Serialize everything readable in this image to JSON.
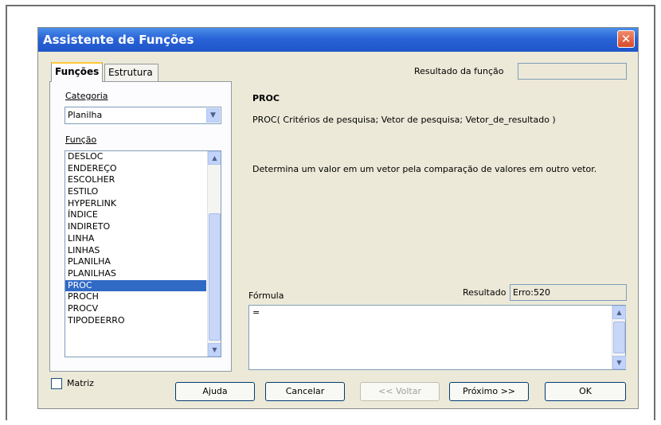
{
  "window": {
    "title": "Assistente de Funções"
  },
  "tabs": {
    "functions": "Funções",
    "structure": "Estrutura"
  },
  "category": {
    "label": "Categoria",
    "selected": "Planilha"
  },
  "function_list": {
    "label": "Função",
    "items": [
      "DESLOC",
      "ENDEREÇO",
      "ESCOLHER",
      "ESTILO",
      "HYPERLINK",
      "ÍNDICE",
      "INDIRETO",
      "LINHA",
      "LINHAS",
      "PLANILHA",
      "PLANILHAS",
      "PROC",
      "PROCH",
      "PROCV",
      "TIPODEERRO"
    ],
    "selected": "PROC"
  },
  "function_result": {
    "label": "Resultado da função",
    "value": ""
  },
  "details": {
    "name": "PROC",
    "syntax": "PROC( Critérios de pesquisa; Vetor de pesquisa; Vetor_de_resultado )",
    "description": "Determina um valor em um vetor pela comparação de valores em outro vetor."
  },
  "formula": {
    "label": "Fórmula",
    "value": "=",
    "result_label": "Resultado",
    "result_value": "Erro:520"
  },
  "footer": {
    "matrix": "Matriz",
    "help": "Ajuda",
    "cancel": "Cancelar",
    "back": "<< Voltar",
    "next": "Próximo >>",
    "ok": "OK"
  },
  "colors": {
    "title_bar": "#2a63d8",
    "selection": "#316ac5",
    "dialog_bg": "#ece9d8"
  }
}
